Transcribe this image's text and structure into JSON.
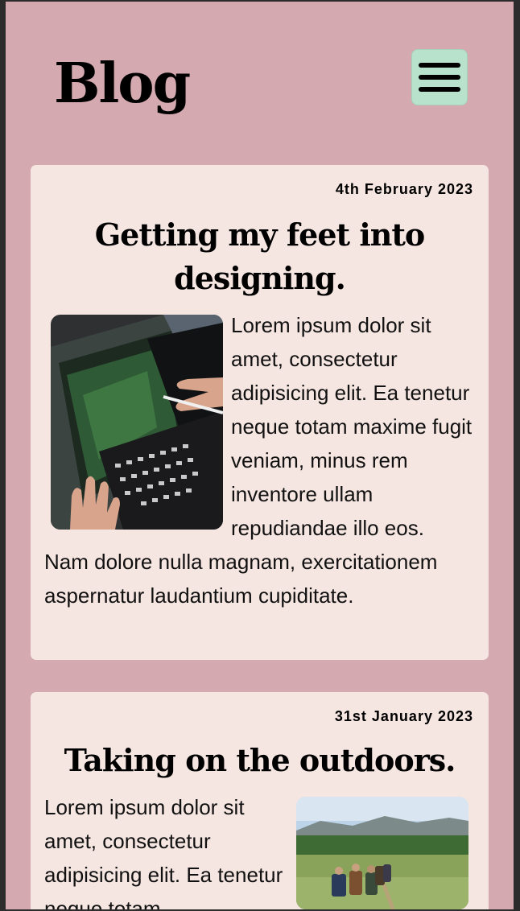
{
  "header": {
    "logo": "Blog"
  },
  "posts": [
    {
      "date": "4th February 2023",
      "title": "Getting my feet into designing.",
      "body": "Lorem ipsum dolor sit amet, consectetur adipisicing elit. Ea tenetur neque totam maxime fugit veniam, minus rem inventore ullam repudiandae illo eos. Nam dolore nulla magnam, exercitationem aspernatur laudantium cupiditate."
    },
    {
      "date": "31st January 2023",
      "title": "Taking on the outdoors.",
      "body": "Lorem ipsum dolor sit amet, consectetur adipisicing elit. Ea tenetur neque totam"
    }
  ],
  "colors": {
    "page_bg": "#d4a9b0",
    "card_bg": "#f6e6e1",
    "menu_bg": "#b8e2cc"
  }
}
